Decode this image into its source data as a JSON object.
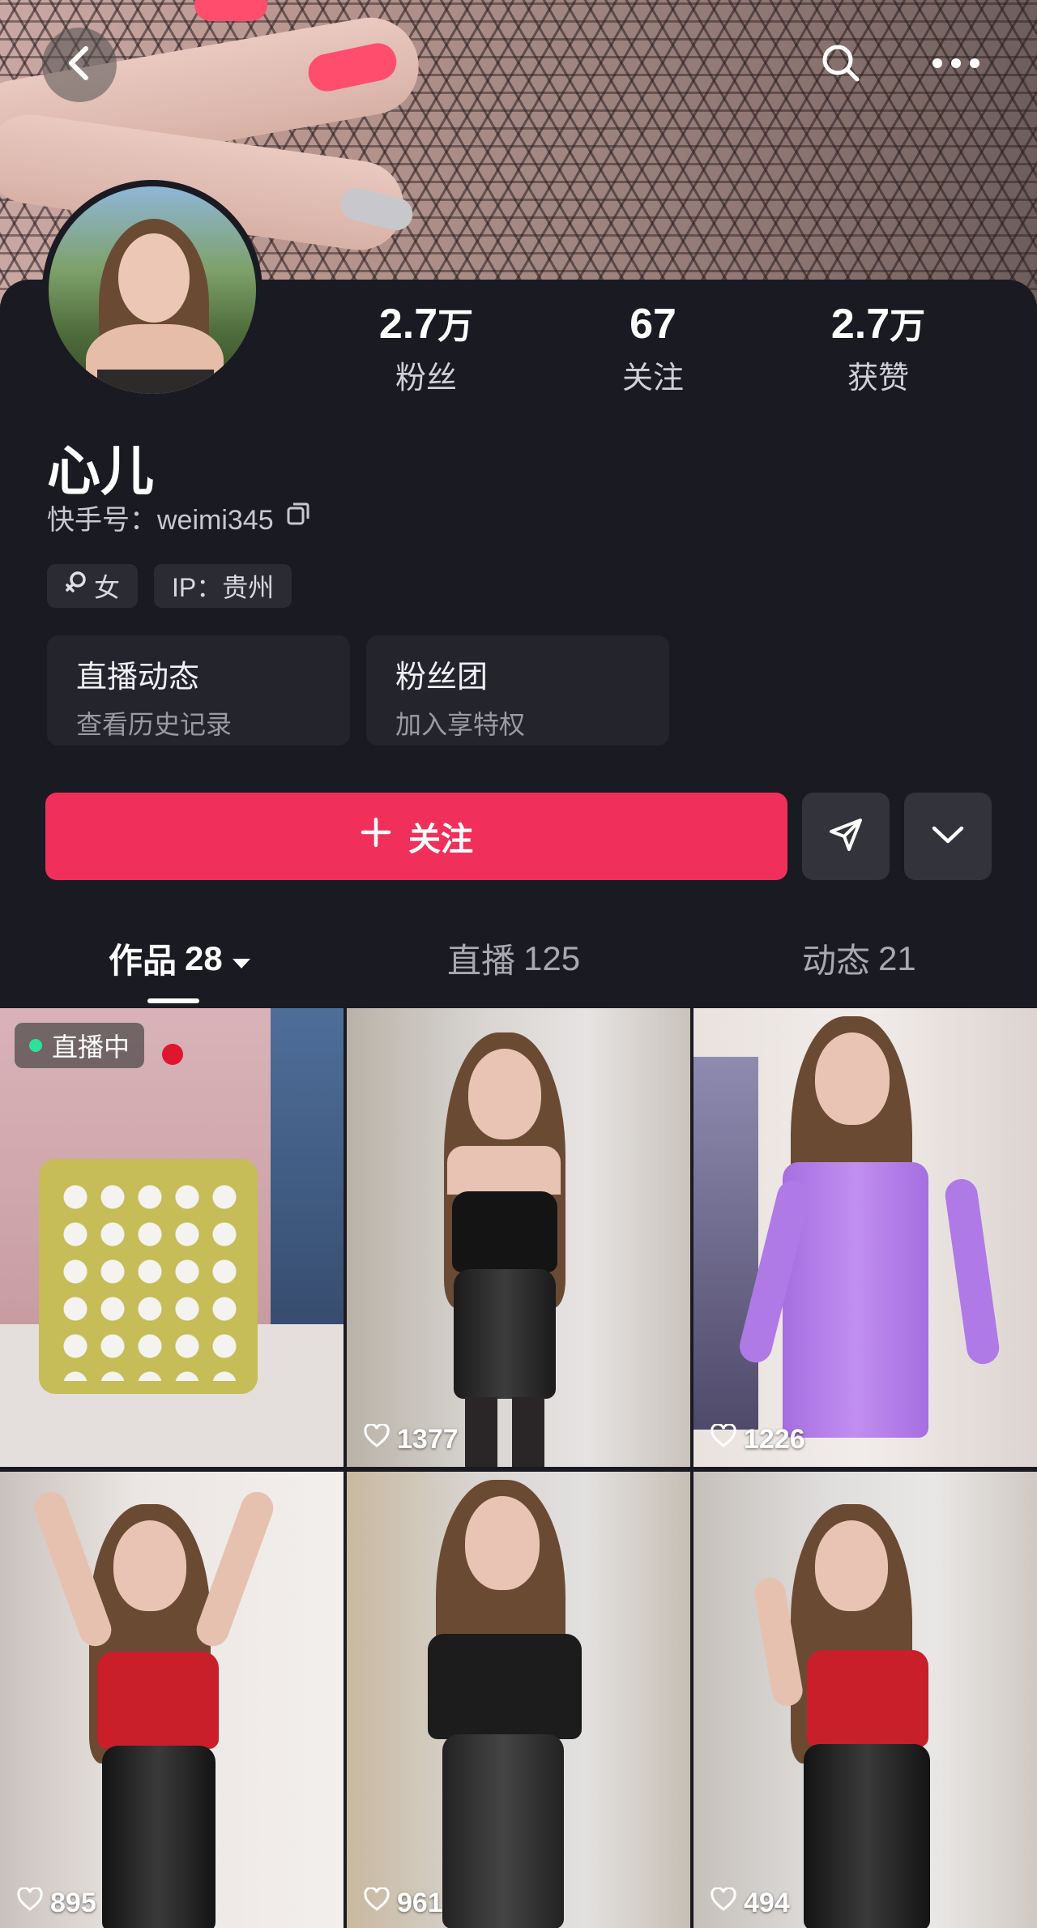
{
  "header": {
    "back_icon": "chevron-left-icon",
    "search_icon": "search-icon",
    "more_icon": "more-dots-icon"
  },
  "profile": {
    "name": "心儿",
    "kuaishou_id_label": "快手号：",
    "kuaishou_id": "weimi345",
    "stats": [
      {
        "value": "2.7",
        "unit": "万",
        "label": "粉丝"
      },
      {
        "value": "67",
        "unit": "",
        "label": "关注"
      },
      {
        "value": "2.7",
        "unit": "万",
        "label": "获赞"
      }
    ],
    "tags": {
      "gender": "女",
      "ip": "IP：贵州"
    },
    "features": [
      {
        "title": "直播动态",
        "subtitle": "查看历史记录"
      },
      {
        "title": "粉丝团",
        "subtitle": "加入享特权"
      }
    ]
  },
  "actions": {
    "follow_label": "关注",
    "follow_color": "#f0305a"
  },
  "tabs": [
    {
      "label": "作品",
      "count": "28"
    },
    {
      "label": "直播",
      "count": "125"
    },
    {
      "label": "动态",
      "count": "21"
    }
  ],
  "grid": [
    {
      "badge": "直播中",
      "likes": ""
    },
    {
      "badge": "",
      "likes": "1377"
    },
    {
      "badge": "",
      "likes": "1226"
    },
    {
      "badge": "",
      "likes": "895"
    },
    {
      "badge": "",
      "likes": "961"
    },
    {
      "badge": "",
      "likes": "494"
    }
  ]
}
